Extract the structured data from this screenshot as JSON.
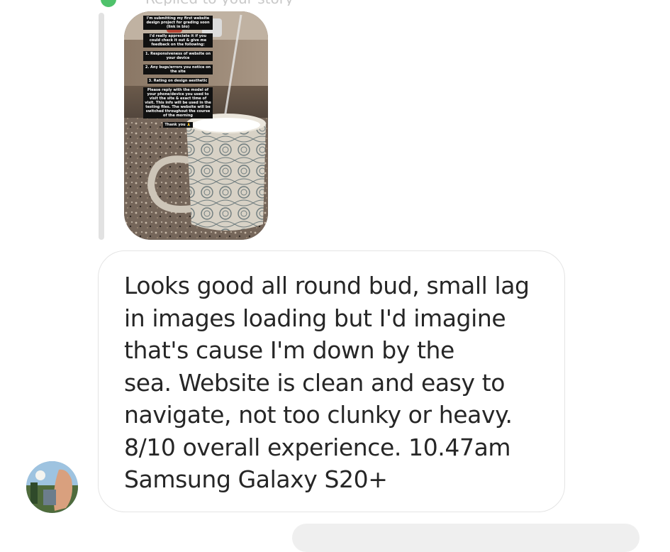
{
  "reply_header": {
    "text": "Replied to your story"
  },
  "story": {
    "caption_lines": [
      "I'm submitting my first website design project for grading soon (link in bio)",
      "I'd really appreciate it if you could check it out & give me feedback on the following:",
      "1. Responsiveness of website on your device",
      "2. Any bugs/errors you notice on the site",
      "3. Rating on design aesthetic",
      "Please reply with the model of your phone/device you used to visit the site & exact time of visit. This info will be used in the testing files. The website will be switched throughout the course of the morning",
      "Thank you 🙏"
    ]
  },
  "message": {
    "text": "Looks good all round bud, small lag\nin images loading but I'd imagine\nthat's cause I'm down by the\nsea. Website is clean and easy to\nnavigate, not too clunky or heavy.\n8/10 overall experience. 10.47am\nSamsung Galaxy S20+"
  },
  "colors": {
    "bubble_border": "#e4e4e4",
    "text": "#262626",
    "reply_bar": "#e2e2e2",
    "online_green": "#4fc26b"
  }
}
